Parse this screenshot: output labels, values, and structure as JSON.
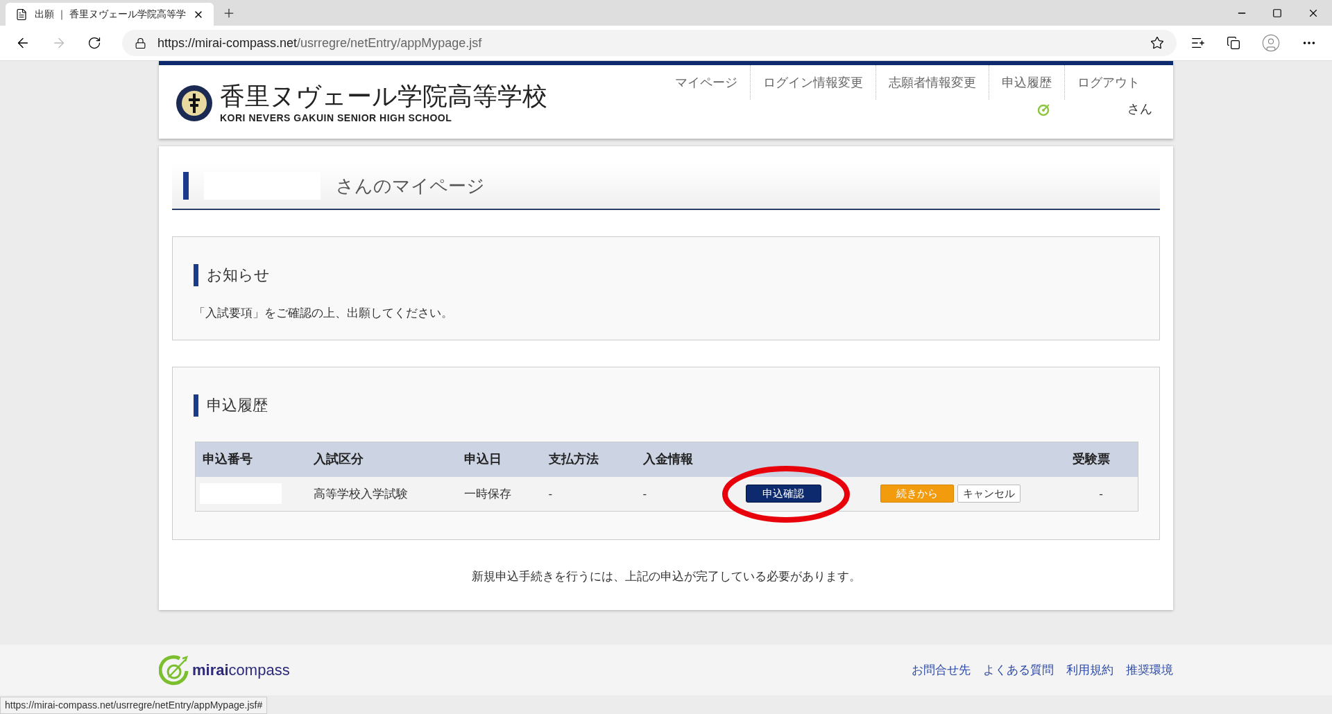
{
  "browser": {
    "tab_title": "出願 ｜ 香里ヌヴェール学院高等学",
    "url_scheme": "https://",
    "url_domain": "mirai-compass.net",
    "url_path": "/usrregre/netEntry/appMypage.jsf",
    "status_url": "https://mirai-compass.net/usrregre/netEntry/appMypage.jsf#"
  },
  "header": {
    "school_name": "香里ヌヴェール学院高等学校",
    "school_name_en": "KORI NEVERS GAKUIN SENIOR HIGH SCHOOL",
    "nav": [
      "マイページ",
      "ログイン情報変更",
      "志願者情報変更",
      "申込履歴",
      "ログアウト"
    ],
    "user_suffix": "さん"
  },
  "page_title": "さんのマイページ",
  "notice": {
    "heading": "お知らせ",
    "text": "「入試要項」をご確認の上、出願してください。"
  },
  "history": {
    "heading": "申込履歴",
    "columns": [
      "申込番号",
      "入試区分",
      "申込日",
      "支払方法",
      "入金情報",
      "受験票"
    ],
    "rows": [
      {
        "exam": "高等学校入学試験",
        "date": "一時保存",
        "payment": "-",
        "deposit": "-",
        "confirm_button": "申込確認",
        "continue_button": "続きから",
        "cancel_button": "キャンセル",
        "ticket": "-"
      }
    ]
  },
  "footnote": "新規申込手続きを行うには、上記の申込が完了している必要があります。",
  "footer": {
    "logo_bold": "mirai",
    "logo_light": "compass",
    "links": [
      "お問合せ先",
      "よくある質問",
      "利用規約",
      "推奨環境"
    ]
  }
}
